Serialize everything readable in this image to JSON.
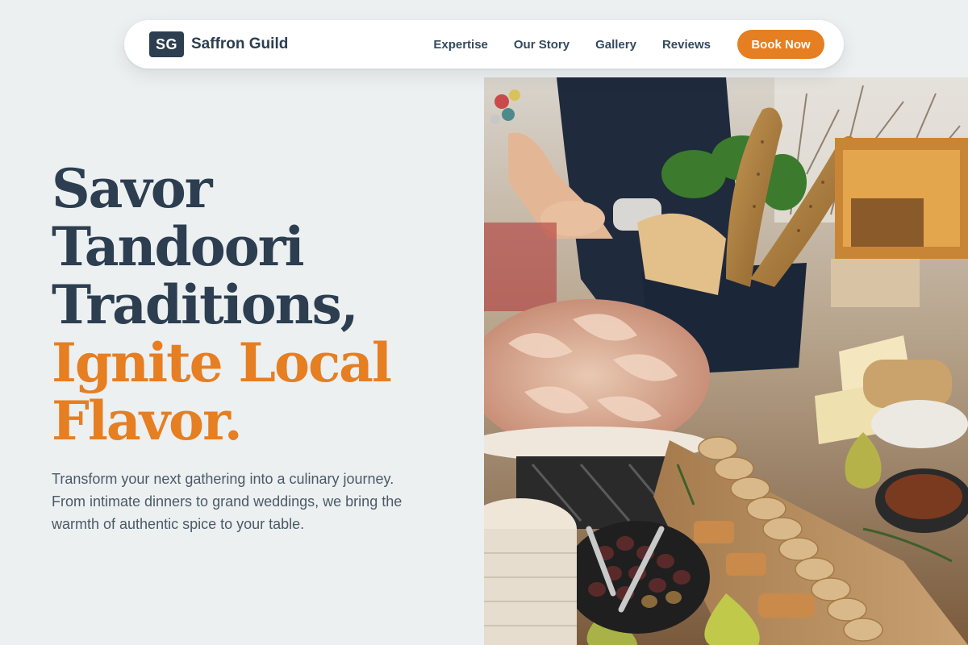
{
  "brand": {
    "logo_text": "SG",
    "name": "Saffron Guild"
  },
  "nav": {
    "links": [
      "Expertise",
      "Our Story",
      "Gallery",
      "Reviews"
    ],
    "cta_label": "Book Now"
  },
  "hero": {
    "headline_lines": [
      "Savor",
      "Tandoori",
      "Traditions,"
    ],
    "headline_accent_lines": [
      "Ignite Local",
      "Flavor."
    ],
    "subtext": "Transform your next gathering into a culinary journey. From intimate dinners to grand weddings, we bring the warmth of authentic spice to your table."
  },
  "image": {
    "subject": "grazing-table-photo"
  },
  "colors": {
    "primary": "#2c3e50",
    "accent": "#e67e22",
    "background": "#edf0f1",
    "text_muted": "#4b5a68"
  }
}
